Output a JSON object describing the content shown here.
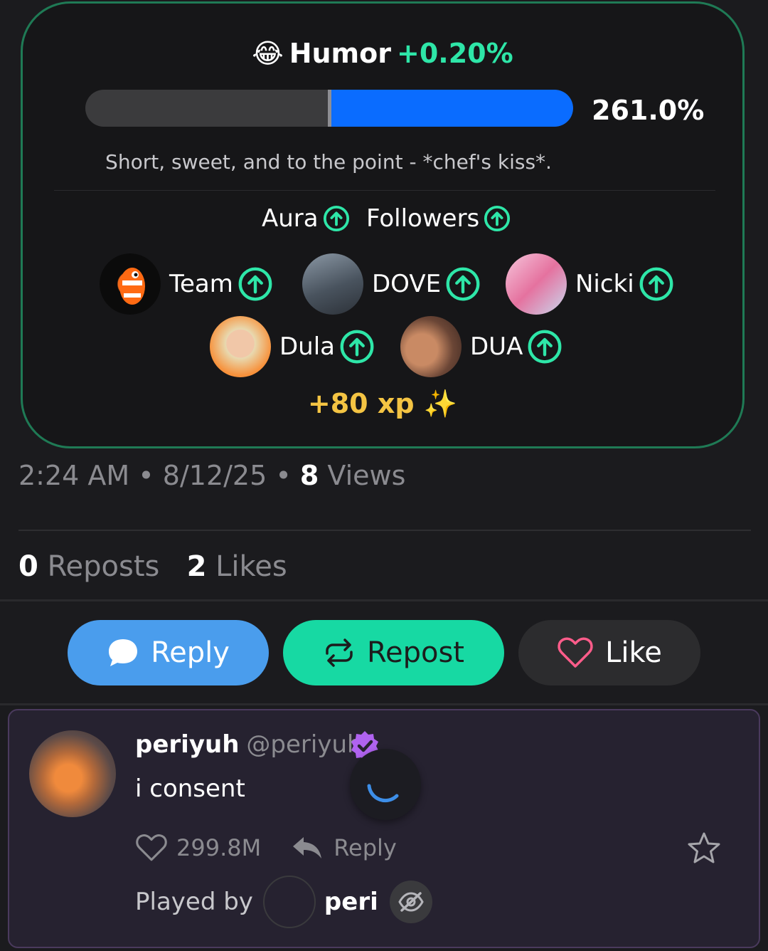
{
  "card": {
    "emoji": "😂",
    "trait": "Humor",
    "trait_delta": "+0.20%",
    "bar_level": 0.5,
    "bar_value": "261.0%",
    "quote": "Short, sweet, and to the point - *chef's kiss*.",
    "stats": [
      "Aura",
      "Followers"
    ],
    "people": [
      {
        "name": "Team"
      },
      {
        "name": "DOVE"
      },
      {
        "name": "Nicki"
      },
      {
        "name": "Dula"
      },
      {
        "name": "DUA"
      }
    ],
    "xp": "+80 xp ✨"
  },
  "meta": {
    "time": "2:24 AM",
    "date": "8/12/25",
    "views_count": "8",
    "views_label": "Views"
  },
  "counts": {
    "reposts_count": "0",
    "reposts_label": "Reposts",
    "likes_count": "2",
    "likes_label": "Likes"
  },
  "actions": {
    "reply": "Reply",
    "repost": "Repost",
    "like": "Like"
  },
  "colors": {
    "reply": "#4a9ded",
    "repost": "#17d9a3",
    "accent_green": "#2ee6a8",
    "bar_blue": "#0a6cff",
    "xp_gold": "#f4c443"
  },
  "reply_post": {
    "name": "periyuh",
    "handle": "@periyuh",
    "text": "i consent",
    "likes": "299.8M",
    "reply_label": "Reply",
    "played_by_label": "Played by",
    "played_by_name": "peri"
  }
}
